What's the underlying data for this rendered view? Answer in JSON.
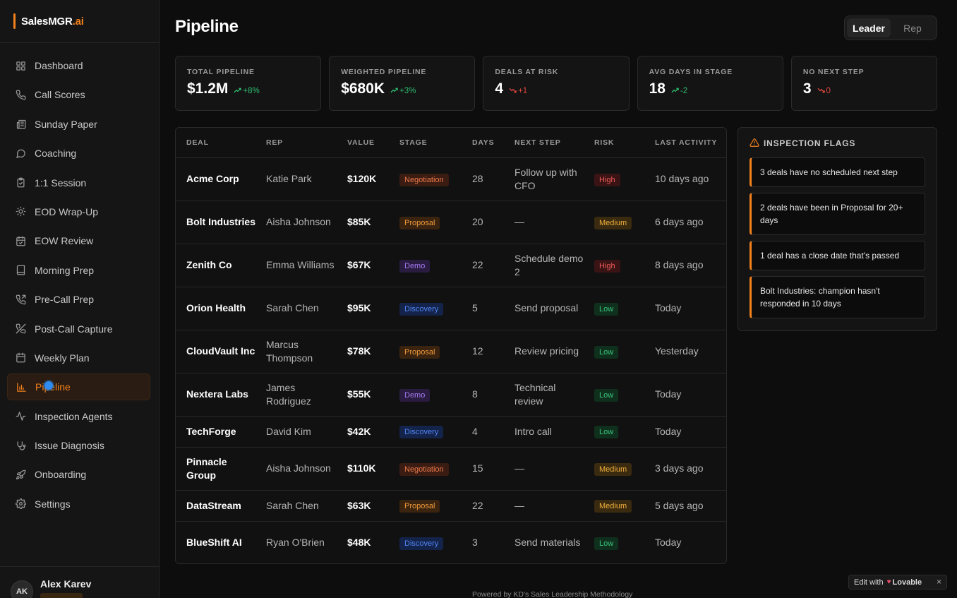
{
  "brand": {
    "name": "SalesMGR",
    "suffix": ".ai",
    "accent": "#f2811d"
  },
  "sidebar": {
    "items": [
      {
        "label": "Dashboard",
        "icon": "grid-icon",
        "active": false
      },
      {
        "label": "Call Scores",
        "icon": "phone-icon",
        "active": false
      },
      {
        "label": "Sunday Paper",
        "icon": "newspaper-icon",
        "active": false
      },
      {
        "label": "Coaching",
        "icon": "message-circle-icon",
        "active": false
      },
      {
        "label": "1:1 Session",
        "icon": "clipboard-icon",
        "active": false
      },
      {
        "label": "EOD Wrap-Up",
        "icon": "sun-icon",
        "active": false
      },
      {
        "label": "EOW Review",
        "icon": "calendar-check-icon",
        "active": false
      },
      {
        "label": "Morning Prep",
        "icon": "book-icon",
        "active": false
      },
      {
        "label": "Pre-Call Prep",
        "icon": "phone-outgoing-icon",
        "active": false
      },
      {
        "label": "Post-Call Capture",
        "icon": "phone-off-icon",
        "active": false
      },
      {
        "label": "Weekly Plan",
        "icon": "calendar-icon",
        "active": false
      },
      {
        "label": "Pipeline",
        "icon": "bar-chart-icon",
        "active": true
      },
      {
        "label": "Inspection Agents",
        "icon": "activity-icon",
        "active": false
      },
      {
        "label": "Issue Diagnosis",
        "icon": "stethoscope-icon",
        "active": false
      },
      {
        "label": "Onboarding",
        "icon": "rocket-icon",
        "active": false
      },
      {
        "label": "Settings",
        "icon": "gear-icon",
        "active": false
      }
    ]
  },
  "user": {
    "initials": "AK",
    "name": "Alex Karev"
  },
  "header": {
    "title": "Pipeline",
    "toggle": [
      "Leader",
      "Rep"
    ],
    "toggle_selected": "Leader"
  },
  "stats": [
    {
      "label": "Total Pipeline",
      "value": "$1.2M",
      "delta": "+8%",
      "trend": "up"
    },
    {
      "label": "Weighted Pipeline",
      "value": "$680K",
      "delta": "+3%",
      "trend": "up"
    },
    {
      "label": "Deals at Risk",
      "value": "4",
      "delta": "+1",
      "trend": "down"
    },
    {
      "label": "Avg Days in Stage",
      "value": "18",
      "delta": "-2",
      "trend": "up"
    },
    {
      "label": "No Next Step",
      "value": "3",
      "delta": "0",
      "trend": "down"
    }
  ],
  "table": {
    "columns": [
      "Deal",
      "Rep",
      "Value",
      "Stage",
      "Days",
      "Next Step",
      "Risk",
      "Last Activity"
    ],
    "rows": [
      {
        "deal": "Acme Corp",
        "rep": "Katie Park",
        "value": "$120K",
        "stage": "Negotiation",
        "days": "28",
        "next": "Follow up with CFO",
        "risk": "High",
        "last": "10 days ago"
      },
      {
        "deal": "Bolt Industries",
        "rep": "Aisha Johnson",
        "value": "$85K",
        "stage": "Proposal",
        "days": "20",
        "next": "—",
        "risk": "Medium",
        "last": "6 days ago"
      },
      {
        "deal": "Zenith Co",
        "rep": "Emma Williams",
        "value": "$67K",
        "stage": "Demo",
        "days": "22",
        "next": "Schedule demo 2",
        "risk": "High",
        "last": "8 days ago"
      },
      {
        "deal": "Orion Health",
        "rep": "Sarah Chen",
        "value": "$95K",
        "stage": "Discovery",
        "days": "5",
        "next": "Send proposal",
        "risk": "Low",
        "last": "Today"
      },
      {
        "deal": "CloudVault Inc",
        "rep": "Marcus Thompson",
        "value": "$78K",
        "stage": "Proposal",
        "days": "12",
        "next": "Review pricing",
        "risk": "Low",
        "last": "Yesterday"
      },
      {
        "deal": "Nextera Labs",
        "rep": "James Rodriguez",
        "value": "$55K",
        "stage": "Demo",
        "days": "8",
        "next": "Technical review",
        "risk": "Low",
        "last": "Today"
      },
      {
        "deal": "TechForge",
        "rep": "David Kim",
        "value": "$42K",
        "stage": "Discovery",
        "days": "4",
        "next": "Intro call",
        "risk": "Low",
        "last": "Today"
      },
      {
        "deal": "Pinnacle Group",
        "rep": "Aisha Johnson",
        "value": "$110K",
        "stage": "Negotiation",
        "days": "15",
        "next": "—",
        "risk": "Medium",
        "last": "3 days ago"
      },
      {
        "deal": "DataStream",
        "rep": "Sarah Chen",
        "value": "$63K",
        "stage": "Proposal",
        "days": "22",
        "next": "—",
        "risk": "Medium",
        "last": "5 days ago"
      },
      {
        "deal": "BlueShift AI",
        "rep": "Ryan O'Brien",
        "value": "$48K",
        "stage": "Discovery",
        "days": "3",
        "next": "Send materials",
        "risk": "Low",
        "last": "Today"
      }
    ]
  },
  "flags": {
    "title": "Inspection Flags",
    "items": [
      "3 deals have no scheduled next step",
      "2 deals have been in Proposal for 20+ days",
      "1 deal has a close date that's passed",
      "Bolt Industries: champion hasn't responded in 10 days"
    ]
  },
  "footer": {
    "note": "Powered by KD's Sales Leadership Methodology"
  },
  "edit_badge": {
    "prefix": "Edit with",
    "brand": "Lovable",
    "close": "×"
  }
}
